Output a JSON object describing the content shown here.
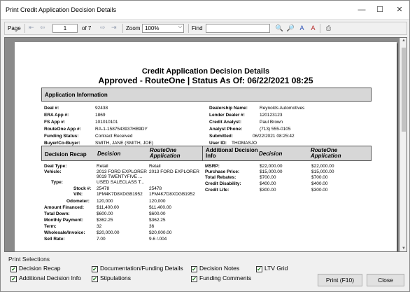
{
  "window": {
    "title": "Print Credit Application Decision Details",
    "min": "—",
    "max": "☐",
    "close": "✕"
  },
  "toolbar": {
    "page_label": "Page",
    "page_value": "1",
    "of_label": "of 7",
    "zoom_label": "Zoom",
    "zoom_value": "100%",
    "find_label": "Find",
    "find_value": ""
  },
  "report": {
    "title": "Credit Application Decision Details",
    "subtitle": "Approved - RouteOne | Status As Of: 06/22/2021 08:25",
    "app_info_header": "Application Information",
    "left_fields": [
      {
        "label": "Deal #:",
        "value": "92438"
      },
      {
        "label": "ERA App #:",
        "value": "1869"
      },
      {
        "label": "FS App #:",
        "value": "101010101"
      },
      {
        "label": "RouteOne App #:",
        "value": "RA-1-1587543937HB9DY"
      },
      {
        "label": "Funding Status:",
        "value": "Contract Received"
      },
      {
        "label": "Buyer/Co-Buyer:",
        "value": "SMITH, JANE (SMITH, JOE)"
      }
    ],
    "right_fields": [
      {
        "label": "Dealership Name:",
        "value": "Reynolds Automotives"
      },
      {
        "label": "Lender Dealer #:",
        "value": "120123123"
      },
      {
        "label": "Credit Analyst:",
        "value": "Paul Brown"
      },
      {
        "label": "Analyst Phone:",
        "value": "(713) 555-0105"
      },
      {
        "label": "Submitted:",
        "value": "06/22/2021 08:25:42"
      },
      {
        "label": "User ID:",
        "value": "THOMASJO"
      }
    ],
    "recap_header": "Decision Recap",
    "col_decision": "Decision",
    "col_routeone": "RouteOne Application",
    "addl_header": "Additional Decision Info",
    "recap_rows": [
      {
        "label": "Deal Type:",
        "decision": "Retail",
        "routeone": "Retail"
      },
      {
        "label": "Vehicle:",
        "decision": "2013 FORD EXPLORER",
        "routeone": "2013 FORD EXPLORER"
      },
      {
        "label": "",
        "decision": "9019 TWENTYFIVE ...",
        "routeone": ""
      },
      {
        "label": "Type:",
        "decision": "USED SALECLASS T...",
        "routeone": ""
      },
      {
        "label": "Stock #:",
        "decision": "25478",
        "routeone": "25478"
      },
      {
        "label": "VIN:",
        "decision": "1FM4K7D8XDGB1952",
        "routeone": "1FM4K7D8XDGB1952"
      },
      {
        "label": "Odometer:",
        "decision": "120,000",
        "routeone": "120,000"
      },
      {
        "label": "Amount Financed:",
        "decision": "$11,400.00",
        "routeone": "$11,400.00"
      },
      {
        "label": "Total Down:",
        "decision": "$600.00",
        "routeone": "$600.00"
      },
      {
        "label": "Monthly Payment:",
        "decision": "$362.25",
        "routeone": "$362.25"
      },
      {
        "label": "Term:",
        "decision": "32",
        "routeone": "36"
      },
      {
        "label": "Wholesale/Invoice:",
        "decision": "$20,000.00",
        "routeone": "$20,000.00"
      },
      {
        "label": "Sell Rate:",
        "decision": "7.00",
        "routeone": "9.6 /.004"
      }
    ],
    "addl_rows": [
      {
        "label": "MSRP:",
        "decision": "$22,000.00",
        "routeone": "$22,000.00"
      },
      {
        "label": "Purchase Price:",
        "decision": "$15,000.00",
        "routeone": "$15,000.00"
      },
      {
        "label": "Total Rebates:",
        "decision": "$700.00",
        "routeone": "$700.00"
      },
      {
        "label": "Credit Disability:",
        "decision": "$400.00",
        "routeone": "$400.00"
      },
      {
        "label": "Credit Life:",
        "decision": "$300.00",
        "routeone": "$300.00"
      }
    ]
  },
  "print_selections": {
    "legend": "Print Selections",
    "options": [
      {
        "label": "Decision Recap",
        "checked": true
      },
      {
        "label": "Documentation/Funding Details",
        "checked": true
      },
      {
        "label": "Decision Notes",
        "checked": true
      },
      {
        "label": "LTV Grid",
        "checked": true
      },
      {
        "label": "Additional Decision Info",
        "checked": true
      },
      {
        "label": "Stipulations",
        "checked": true
      },
      {
        "label": "Funding Comments",
        "checked": true
      }
    ],
    "print_button": "Print (F10)",
    "close_button": "Close"
  }
}
